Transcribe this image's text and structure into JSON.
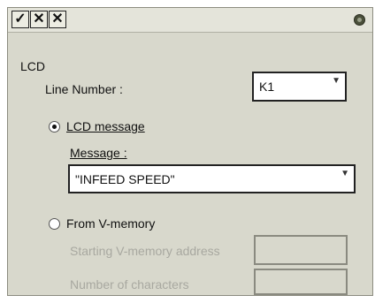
{
  "toolbar": {
    "ok_icon": "check-icon",
    "cancel_icon": "x-icon",
    "close_icon": "close-x-icon",
    "ok_glyph": "✓",
    "cancel_glyph": "✕",
    "close_glyph": "✕"
  },
  "section": {
    "title": "LCD"
  },
  "line_number": {
    "label": "Line Number :",
    "value": "K1"
  },
  "option_lcd_message": {
    "label": "LCD message",
    "selected": true
  },
  "message": {
    "label": "Message :",
    "value": "\"INFEED SPEED\""
  },
  "option_v_memory": {
    "label": "From V-memory",
    "selected": false
  },
  "starting_v_memory": {
    "label": "Starting V-memory address",
    "value": ""
  },
  "number_of_characters": {
    "label": "Number of characters",
    "value": ""
  },
  "colors": {
    "dialog_bg": "#d8d8cc",
    "field_bg": "#ffffff",
    "disabled_text": "#a8a8a0"
  }
}
